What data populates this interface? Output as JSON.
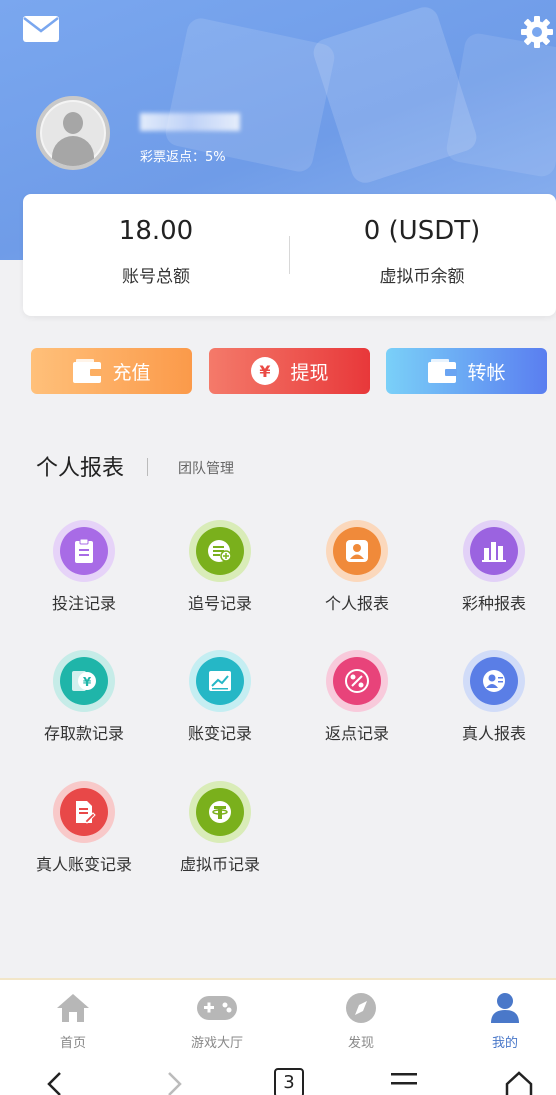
{
  "header": {
    "rebate_label": "彩票返点：5%",
    "icons": [
      "mail-icon",
      "gear-icon"
    ]
  },
  "balance": {
    "total_amount": "18.00",
    "total_label": "账号总额",
    "crypto_amount": "0 (USDT)",
    "crypto_label": "虚拟币余额"
  },
  "actions": {
    "recharge": "充值",
    "withdraw": "提现",
    "transfer": "转帐"
  },
  "section": {
    "title": "个人报表",
    "team": "团队管理"
  },
  "grid": [
    {
      "label": "投注记录",
      "icon": "clipboard-icon",
      "color": "#a86be6"
    },
    {
      "label": "追号记录",
      "icon": "list-add-icon",
      "color": "#7ab01c"
    },
    {
      "label": "个人报表",
      "icon": "person-icon",
      "color": "#f08a3a"
    },
    {
      "label": "彩种报表",
      "icon": "bar-chart-icon",
      "color": "#9b63e0"
    },
    {
      "label": "存取款记录",
      "icon": "yen-card-icon",
      "color": "#1fb5a9"
    },
    {
      "label": "账变记录",
      "icon": "trend-chart-icon",
      "color": "#25b7c6"
    },
    {
      "label": "返点记录",
      "icon": "percent-icon",
      "color": "#e8437a"
    },
    {
      "label": "真人报表",
      "icon": "id-card-icon",
      "color": "#5a7ee6"
    },
    {
      "label": "真人账变记录",
      "icon": "document-edit-icon",
      "color": "#e84848"
    },
    {
      "label": "虚拟币记录",
      "icon": "tether-icon",
      "color": "#7ab01c"
    }
  ],
  "tabbar": [
    {
      "label": "首页",
      "icon": "home-icon"
    },
    {
      "label": "游戏大厅",
      "icon": "gamepad-icon"
    },
    {
      "label": "发现",
      "icon": "compass-icon"
    },
    {
      "label": "我的",
      "icon": "user-icon"
    }
  ],
  "system_nav": {
    "tab_count": "3"
  }
}
